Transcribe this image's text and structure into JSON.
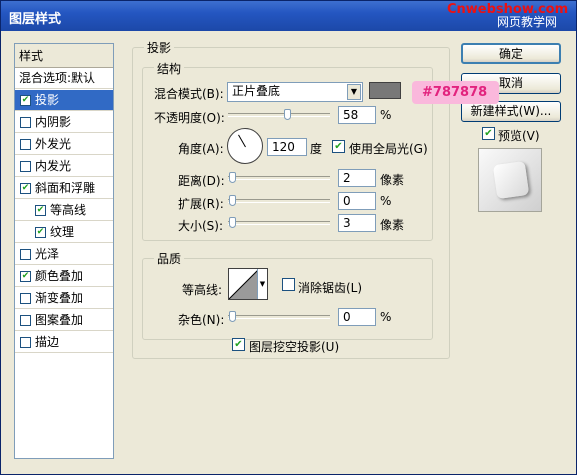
{
  "window": {
    "title": "图层样式",
    "watermark_top": "Cnwebshow.com",
    "watermark_bottom": "网页教学网",
    "close_symbol": "x"
  },
  "sidebar": {
    "header": "样式",
    "items": [
      {
        "label": "混合选项:默认",
        "checkbox": false,
        "checked": false,
        "selected": false,
        "indent": false
      },
      {
        "label": "投影",
        "checkbox": true,
        "checked": true,
        "selected": true,
        "indent": false
      },
      {
        "label": "内阴影",
        "checkbox": true,
        "checked": false,
        "selected": false,
        "indent": false
      },
      {
        "label": "外发光",
        "checkbox": true,
        "checked": false,
        "selected": false,
        "indent": false
      },
      {
        "label": "内发光",
        "checkbox": true,
        "checked": false,
        "selected": false,
        "indent": false
      },
      {
        "label": "斜面和浮雕",
        "checkbox": true,
        "checked": true,
        "selected": false,
        "indent": false
      },
      {
        "label": "等高线",
        "checkbox": true,
        "checked": true,
        "selected": false,
        "indent": true
      },
      {
        "label": "纹理",
        "checkbox": true,
        "checked": true,
        "selected": false,
        "indent": true
      },
      {
        "label": "光泽",
        "checkbox": true,
        "checked": false,
        "selected": false,
        "indent": false
      },
      {
        "label": "颜色叠加",
        "checkbox": true,
        "checked": true,
        "selected": false,
        "indent": false
      },
      {
        "label": "渐变叠加",
        "checkbox": true,
        "checked": false,
        "selected": false,
        "indent": false
      },
      {
        "label": "图案叠加",
        "checkbox": true,
        "checked": false,
        "selected": false,
        "indent": false
      },
      {
        "label": "描边",
        "checkbox": true,
        "checked": false,
        "selected": false,
        "indent": false
      }
    ]
  },
  "drop_shadow": {
    "title": "投影",
    "structure": {
      "title": "结构",
      "blend_mode_label": "混合模式(B):",
      "blend_mode_value": "正片叠底",
      "shadow_color": "#787878",
      "opacity_label": "不透明度(O):",
      "opacity_value": "58",
      "opacity_unit": "%",
      "angle_label": "角度(A):",
      "angle_value": "120",
      "angle_unit": "度",
      "global_light_label": "使用全局光(G)",
      "global_light_checked": true,
      "distance_label": "距离(D):",
      "distance_value": "2",
      "distance_unit": "像素",
      "spread_label": "扩展(R):",
      "spread_value": "0",
      "spread_unit": "%",
      "size_label": "大小(S):",
      "size_value": "3",
      "size_unit": "像素"
    },
    "quality": {
      "title": "品质",
      "contour_label": "等高线:",
      "anti_alias_label": "消除锯齿(L)",
      "anti_alias_checked": false,
      "noise_label": "杂色(N):",
      "noise_value": "0",
      "noise_unit": "%"
    },
    "knockout_label": "图层挖空投影(U)",
    "knockout_checked": true
  },
  "buttons": {
    "ok": "确定",
    "cancel": "取消",
    "new_style": "新建样式(W)...",
    "preview_label": "预览(V)",
    "preview_checked": true
  },
  "annotation": {
    "text": "#787878",
    "bg_color": "#fab8dc",
    "text_color": "#e2237e"
  },
  "colors": {
    "title_bar": "#2456c1",
    "selection": "#316ac5",
    "dialog_bg": "#ece9d8",
    "shadow_swatch": "#787878"
  }
}
